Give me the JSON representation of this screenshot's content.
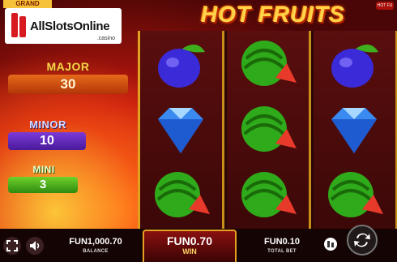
{
  "logo": {
    "text": "AllSlotsOnline",
    "sub": ".casino",
    "stub": "GRAND"
  },
  "title": "HOT FRUITS",
  "corner_badge": "HOT FU",
  "jackpots": {
    "major": {
      "label": "MAJOR",
      "value": "30"
    },
    "minor": {
      "label": "MINOR",
      "value": "10"
    },
    "mini": {
      "label": "MINI",
      "value": "3"
    }
  },
  "reels": [
    [
      "plum",
      "diamond",
      "watermelon"
    ],
    [
      "watermelon",
      "watermelon",
      "watermelon"
    ],
    [
      "plum",
      "diamond",
      "watermelon"
    ]
  ],
  "footer": {
    "balance_value": "FUN1,000.70",
    "balance_label": "BALANCE",
    "win_value": "FUN0.70",
    "win_label": "WIN",
    "bet_value": "FUN0.10",
    "bet_label": "TOTAL BET"
  },
  "icons": [
    "fullscreen-icon",
    "sound-icon",
    "chip-stack-icon",
    "spin-icon"
  ],
  "colors": {
    "gold": "#ffd34a",
    "major": "#e56a1a",
    "minor": "#7b3ad8",
    "mini": "#6fd12a"
  }
}
